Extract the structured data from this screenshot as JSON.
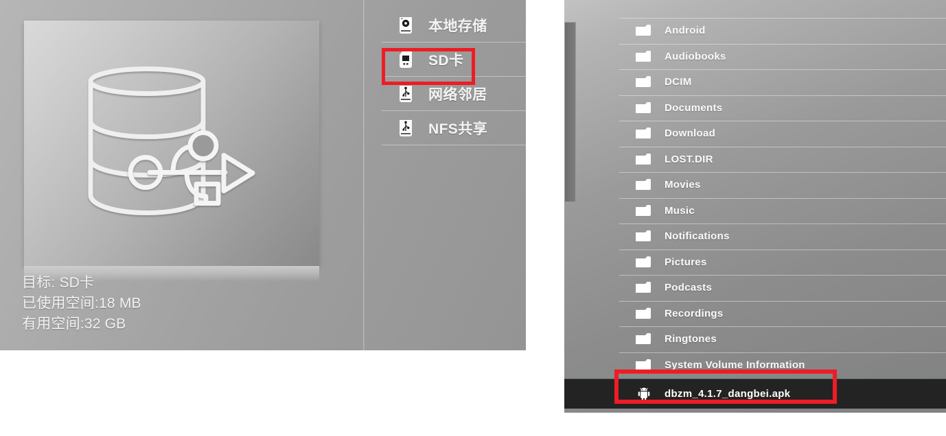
{
  "colors": {
    "highlight_red": "#ee1c25",
    "selected_row_bg": "#232323",
    "text": "#f4f4f4"
  },
  "left_panel": {
    "preview": {
      "icon": "usb-storage-database-icon"
    },
    "info": {
      "target": "目标: SD卡",
      "used_space": "已使用空间:18 MB",
      "free_space": "有用空间:32 GB"
    },
    "menu": {
      "items": [
        {
          "label": "本地存储",
          "icon": "hard-disk-icon",
          "selected": false
        },
        {
          "label": "SD卡",
          "icon": "sd-card-icon",
          "selected": true
        },
        {
          "label": "网络邻居",
          "icon": "usb-network-icon",
          "selected": false
        },
        {
          "label": "NFS共享",
          "icon": "usb-nfs-icon",
          "selected": false
        }
      ]
    }
  },
  "right_panel": {
    "files": [
      {
        "name": "Android",
        "type": "folder"
      },
      {
        "name": "Audiobooks",
        "type": "folder"
      },
      {
        "name": "DCIM",
        "type": "folder"
      },
      {
        "name": "Documents",
        "type": "folder"
      },
      {
        "name": "Download",
        "type": "folder"
      },
      {
        "name": "LOST.DIR",
        "type": "folder"
      },
      {
        "name": "Movies",
        "type": "folder"
      },
      {
        "name": "Music",
        "type": "folder"
      },
      {
        "name": "Notifications",
        "type": "folder"
      },
      {
        "name": "Pictures",
        "type": "folder"
      },
      {
        "name": "Podcasts",
        "type": "folder"
      },
      {
        "name": "Recordings",
        "type": "folder"
      },
      {
        "name": "Ringtones",
        "type": "folder"
      },
      {
        "name": "System Volume Information",
        "type": "folder"
      }
    ],
    "selected_file": {
      "name": "dbzm_4.1.7_dangbei.apk",
      "type": "apk",
      "icon": "android-robot-icon"
    }
  }
}
